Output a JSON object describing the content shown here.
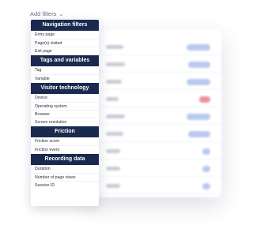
{
  "header": {
    "label": "Add filters"
  },
  "menu": {
    "sections": [
      {
        "title": "Navigation filters",
        "items": [
          "Entry page",
          "Page(s) visited",
          "Exit page"
        ]
      },
      {
        "title": "Tags and variables",
        "items": [
          "Tag",
          "Variable"
        ]
      },
      {
        "title": "Visitor technology",
        "items": [
          "Device",
          "Operating system",
          "Browser",
          "Screen resolution"
        ]
      },
      {
        "title": "Friction",
        "items": [
          "Friction score",
          "Friction event"
        ]
      },
      {
        "title": "Recording data",
        "items": [
          "Duration",
          "Number of page views",
          "Session ID"
        ]
      }
    ]
  },
  "colors": {
    "section_header_bg": "#1a2a4f",
    "pill_blue": "#b9c9ef",
    "pill_red": "#e98f9a"
  }
}
